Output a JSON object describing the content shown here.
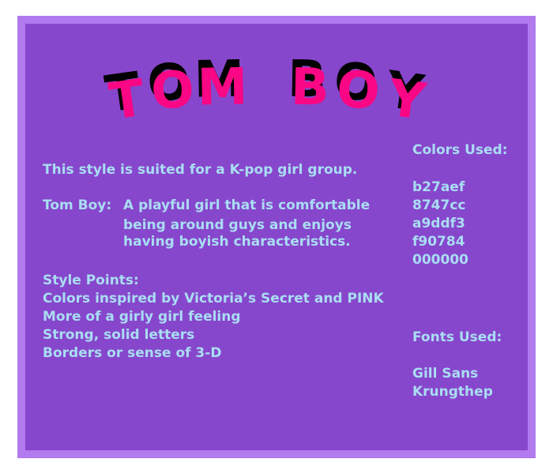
{
  "title": {
    "text": "TOM BOY",
    "letters": [
      "T",
      "O",
      "M",
      " ",
      "B",
      "O",
      "Y"
    ]
  },
  "intro": "This style is suited for a K-pop girl group.",
  "tom_boy": {
    "label": "Tom Boy:",
    "lines": [
      "A playful girl that is comfortable",
      "being around guys and enjoys",
      "having boyish characteristics."
    ]
  },
  "style_points": {
    "heading": "Style Points:",
    "items": [
      "Colors inspired by Victoria’s Secret and PINK",
      "More of a girly girl feeling",
      "Strong, solid letters",
      "Borders or sense of 3-D"
    ]
  },
  "colors_used": {
    "heading": "Colors Used:",
    "values": [
      "b27aef",
      "8747cc",
      "a9ddf3",
      "f90784",
      "000000"
    ]
  },
  "fonts_used": {
    "heading": "Fonts Used:",
    "values": [
      "Gill Sans",
      "Krungthep"
    ]
  },
  "palette": {
    "outer_border": "#b27aef",
    "panel": "#8747cc",
    "text": "#a9ddf3",
    "title_front": "#f90784",
    "title_shadow": "#000000"
  }
}
